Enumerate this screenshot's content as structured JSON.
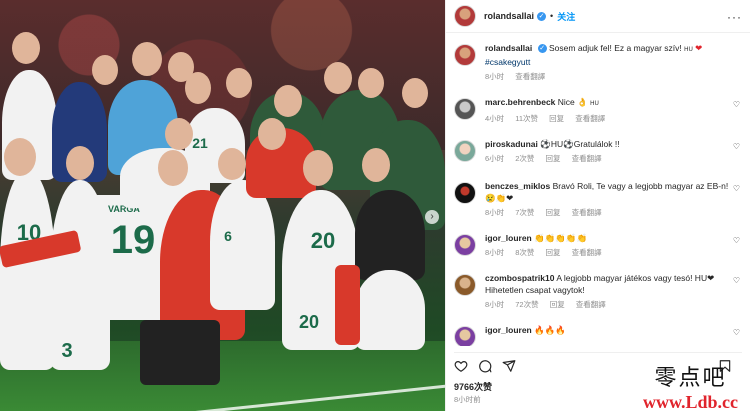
{
  "post": {
    "author": "rolandsallai",
    "follow_label": "关注",
    "caption_text": "Sosem adjuk fel! Ez a magyar szív! ",
    "caption_suffix": "HU",
    "caption_emoji": "❤",
    "caption_hashtag": "#csakegyutt",
    "caption_time": "8小时",
    "caption_translate": "查看翻譯",
    "likes": "9766次赞",
    "posted": "8小时前"
  },
  "photo": {
    "player_name": "VARGA",
    "numbers": [
      "19",
      "20",
      "20",
      "10",
      "21",
      "6",
      "3"
    ]
  },
  "comments": [
    {
      "user": "marc.behrenbeck",
      "text": "Nice 👌",
      "suffix": "HU",
      "time": "4小时",
      "likes": "11次赞",
      "reply": "回复",
      "translate": "查看翻譯"
    },
    {
      "user": "piroskadunai",
      "text": "⚽HU⚽Gratulálok !!",
      "suffix": "",
      "time": "6小时",
      "likes": "2次赞",
      "reply": "回复",
      "translate": "查看翻譯"
    },
    {
      "user": "benczes_miklos",
      "text": "Bravó Roli, Te vagy a legjobb magyar az EB-n!",
      "suffix": "",
      "extra": "😢👏❤",
      "time": "8小时",
      "likes": "7次赞",
      "reply": "回复",
      "translate": "查看翻譯"
    },
    {
      "user": "igor_louren",
      "text": "👏👏👏👏👏",
      "suffix": "",
      "time": "8小时",
      "likes": "8次赞",
      "reply": "回复",
      "translate": "查看翻譯"
    },
    {
      "user": "czombospatrik10",
      "text": "A legjobb magyar játékos vagy tesó! HU❤",
      "suffix": "",
      "extra": "Hihetetlen csapat vagytok!",
      "time": "8小时",
      "likes": "72次赞",
      "reply": "回复",
      "translate": "查看翻譯"
    },
    {
      "user": "igor_louren",
      "text": "🔥🔥🔥",
      "suffix": "",
      "time": "8小时",
      "likes": "",
      "reply": "",
      "translate": ""
    }
  ],
  "watermark": {
    "cn": "零点吧",
    "url": "www.Ldb.cc"
  },
  "colors": {
    "link": "#0095f6",
    "verified": "#3897f0",
    "heart": "#e0242c",
    "muted": "#8e8e8e"
  }
}
